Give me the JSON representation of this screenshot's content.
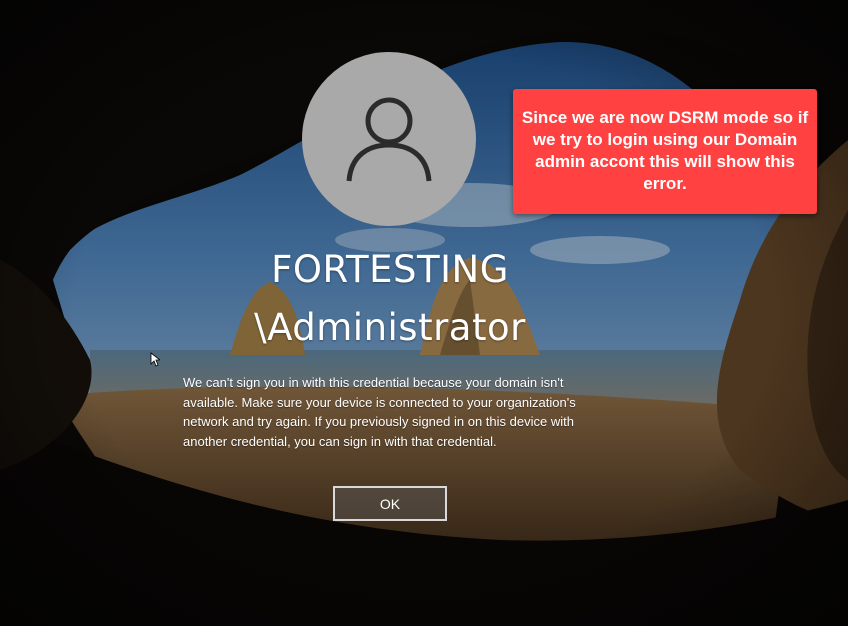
{
  "user": {
    "line1": "FORTESTING",
    "line2": "\\Administrator",
    "avatar_icon": "user-silhouette-icon"
  },
  "error": {
    "message": "We can't sign you in with this credential because your domain isn't available. Make sure your device is connected to your organization's network and try again. If you previously signed in on this device with another credential, you can sign in with that credential."
  },
  "ok_button": {
    "label": "OK"
  },
  "annotation": {
    "text": "Since we are now DSRM mode so if we try to login using our Domain admin accont this will show this error.",
    "color": "#ff4141"
  },
  "colors": {
    "avatar_bg": "#a9a9a9",
    "text": "#ffffff"
  }
}
